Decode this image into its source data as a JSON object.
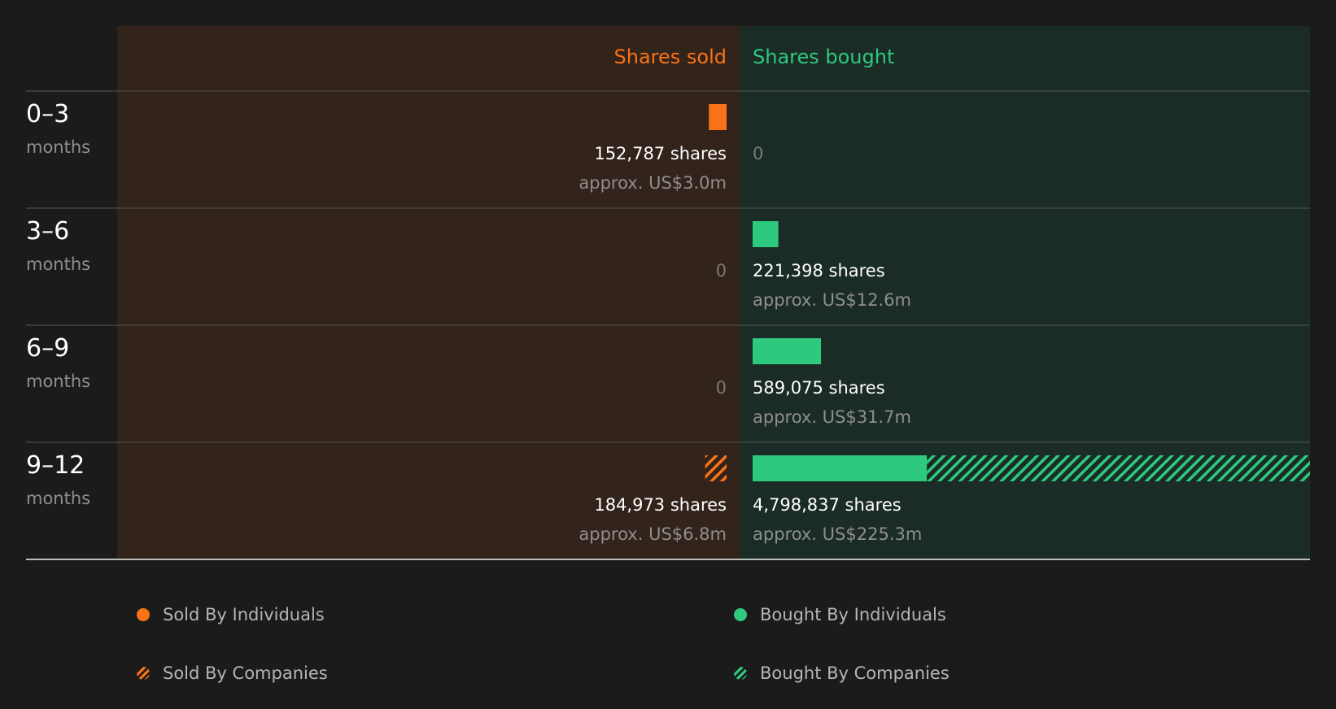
{
  "colors": {
    "sold": "#f97316",
    "bought": "#2dc97e",
    "sold_bg": "#32231b",
    "bought_bg": "#1b2b25",
    "page_bg": "#1b1b1b",
    "text": "#ffffff",
    "muted": "#8f8f8f",
    "zero": "#7a7a7a"
  },
  "chart_data": {
    "type": "bar",
    "columns": {
      "sold": "Shares sold",
      "bought": "Shares bought"
    },
    "categories": [
      {
        "range": "0–3",
        "unit": "months"
      },
      {
        "range": "3–6",
        "unit": "months"
      },
      {
        "range": "6–9",
        "unit": "months"
      },
      {
        "range": "9–12",
        "unit": "months"
      }
    ],
    "series": [
      {
        "name": "Sold By Individuals",
        "side": "sold",
        "kind": "individuals",
        "values": [
          152787,
          0,
          0,
          0
        ]
      },
      {
        "name": "Sold By Companies",
        "side": "sold",
        "kind": "companies",
        "values": [
          0,
          0,
          0,
          184973
        ]
      },
      {
        "name": "Bought By Individuals",
        "side": "bought",
        "kind": "individuals",
        "values": [
          0,
          221398,
          589075,
          1500000
        ]
      },
      {
        "name": "Bought By Companies",
        "side": "bought",
        "kind": "companies",
        "values": [
          0,
          0,
          0,
          3298837
        ]
      }
    ],
    "sold_labels": [
      {
        "shares": "152,787 shares",
        "value": "approx. US$3.0m"
      },
      {
        "zero": "0"
      },
      {
        "zero": "0"
      },
      {
        "shares": "184,973 shares",
        "value": "approx. US$6.8m"
      }
    ],
    "bought_labels": [
      {
        "zero": "0"
      },
      {
        "shares": "221,398 shares",
        "value": "approx. US$12.6m"
      },
      {
        "shares": "589,075 shares",
        "value": "approx. US$31.7m"
      },
      {
        "shares": "4,798,837 shares",
        "value": "approx. US$225.3m"
      }
    ],
    "max_value": 4798837
  },
  "legend": [
    {
      "label": "Sold By Individuals",
      "style": "solid",
      "side": "sold"
    },
    {
      "label": "Bought By Individuals",
      "style": "solid",
      "side": "bought"
    },
    {
      "label": "Sold By Companies",
      "style": "hatch",
      "side": "sold"
    },
    {
      "label": "Bought By Companies",
      "style": "hatch",
      "side": "bought"
    }
  ]
}
